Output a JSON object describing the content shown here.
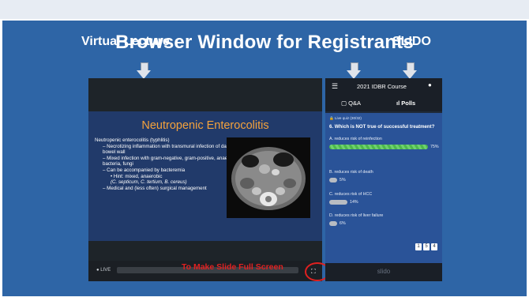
{
  "slide": {
    "title": "Browser Window for Registrants",
    "left_label": "Virtual Lecture",
    "right_label": "SLIDO",
    "callout": "To Make Slide Full Screen"
  },
  "lecture": {
    "slide_title": "Neutropenic Enterocolitis",
    "bullets": [
      "Neutropenic enterocolitis (typhlitis)",
      "– Necrotizing inflammation with transmural infection of damaged bowel wall",
      "– Mixed infection with gram-negative, gram-positive, anaerobic bacteria, fungi",
      "– Can be accompanied by bacteremia",
      "• Hint: mixed, anaerobic",
      "(C. septicum, C. tertium, B. cereus)",
      "– Medical and (less often) surgical management"
    ],
    "live_label": "LIVE",
    "fullscreen_icon": "fullscreen-icon"
  },
  "slido": {
    "event_title": "2021 IDBR Course",
    "tabs": [
      "Q&A",
      "Polls"
    ],
    "live_quiz": "Live quiz (30/32)",
    "question": "6. Which is NOT true of successful treatment?",
    "options": [
      {
        "label": "A. reduces risk of reinfection",
        "percent": 75,
        "pct_text": "75%"
      },
      {
        "label": "B. reduces risk of death",
        "percent": 5,
        "pct_text": "5%"
      },
      {
        "label": "C. reduces risk of HCC",
        "percent": 14,
        "pct_text": "14%"
      },
      {
        "label": "D. reduces risk of liver failure",
        "percent": 6,
        "pct_text": "6%"
      }
    ],
    "pages": [
      "1",
      "5",
      "4"
    ],
    "brand": "slido"
  },
  "colors": {
    "slide_bg": "#2e65a6",
    "callout": "#e02020",
    "accent_orange": "#f4a23c",
    "correct_green": "#4cb84c"
  }
}
